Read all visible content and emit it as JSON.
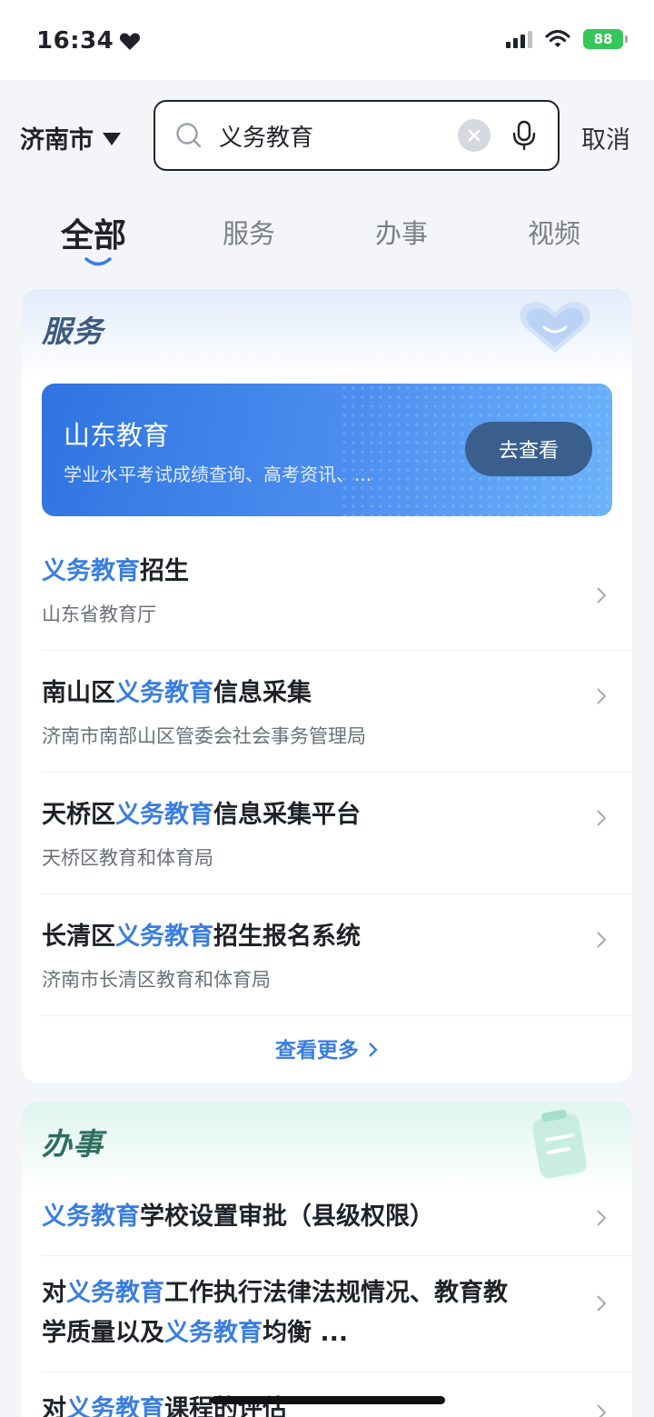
{
  "status_bar": {
    "time": "16:34",
    "battery": "88"
  },
  "header": {
    "city": "济南市",
    "search_value": "义务教育",
    "cancel_label": "取消"
  },
  "tabs": [
    {
      "label": "全部",
      "active": true
    },
    {
      "label": "服务",
      "active": false
    },
    {
      "label": "办事",
      "active": false
    },
    {
      "label": "视频",
      "active": false
    }
  ],
  "services_section": {
    "title": "服务",
    "banner": {
      "title": "山东教育",
      "subtitle": "学业水平考试成绩查询、高考资讯、...",
      "button_label": "去查看"
    },
    "items": [
      {
        "prefix": "",
        "highlight": "义务教育",
        "suffix": "招生",
        "subtitle": "山东省教育厅"
      },
      {
        "prefix": "南山区",
        "highlight": "义务教育",
        "suffix": "信息采集",
        "subtitle": "济南市南部山区管委会社会事务管理局"
      },
      {
        "prefix": "天桥区",
        "highlight": "义务教育",
        "suffix": "信息采集平台",
        "subtitle": "天桥区教育和体育局"
      },
      {
        "prefix": "长清区",
        "highlight": "义务教育",
        "suffix": "招生报名系统",
        "subtitle": "济南市长清区教育和体育局"
      }
    ],
    "more_label": "查看更多"
  },
  "affairs_section": {
    "title": "办事",
    "items": [
      {
        "p1": "",
        "h1": "义务教育",
        "p2": "学校设置审批（县级权限）"
      },
      {
        "p1": "对",
        "h1": "义务教育",
        "p2": "工作执行法律法规情况、教育教",
        "line2_prefix": "学质量以及",
        "h2": "义务教育",
        "line2_suffix": "均衡 ..."
      },
      {
        "p1": "对",
        "h1": "义务教育",
        "p2": "课程的评估"
      }
    ]
  },
  "colors": {
    "accent": "#3a7de0",
    "battery": "#34c759",
    "banner_button": "#3b5f8d"
  }
}
